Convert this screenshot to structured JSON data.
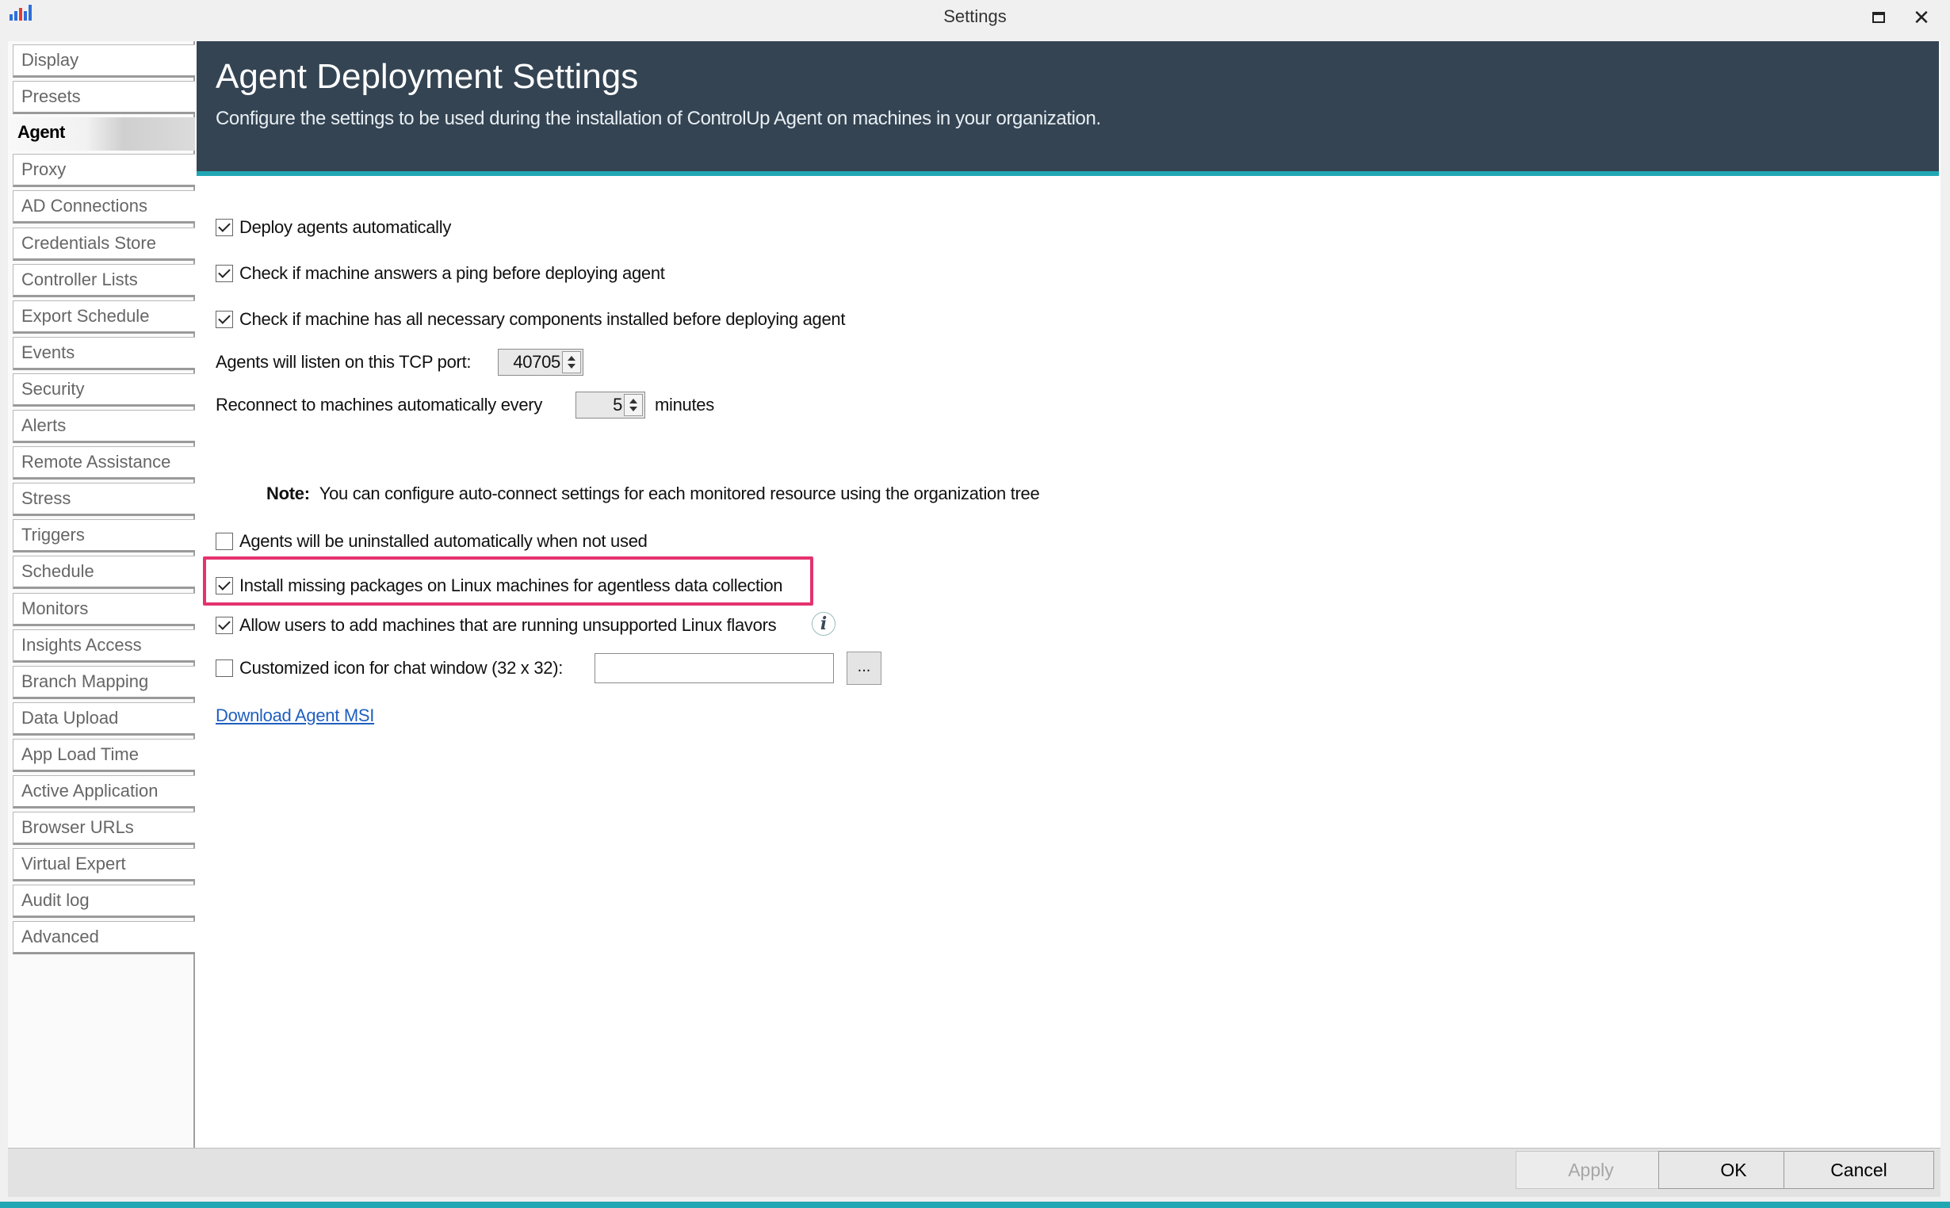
{
  "window": {
    "title": "Settings",
    "maximize_label": "",
    "close_label": "✕"
  },
  "sidebar": {
    "items": [
      {
        "label": "Display"
      },
      {
        "label": "Presets"
      },
      {
        "label": "Agent",
        "selected": true
      },
      {
        "label": "Proxy"
      },
      {
        "label": "AD Connections"
      },
      {
        "label": "Credentials Store"
      },
      {
        "label": "Controller Lists"
      },
      {
        "label": "Export Schedule"
      },
      {
        "label": "Events"
      },
      {
        "label": "Security"
      },
      {
        "label": "Alerts"
      },
      {
        "label": "Remote Assistance"
      },
      {
        "label": "Stress"
      },
      {
        "label": "Triggers"
      },
      {
        "label": "Schedule"
      },
      {
        "label": "Monitors"
      },
      {
        "label": "Insights Access"
      },
      {
        "label": "Branch Mapping"
      },
      {
        "label": "Data Upload"
      },
      {
        "label": "App Load Time"
      },
      {
        "label": "Active Application"
      },
      {
        "label": "Browser URLs"
      },
      {
        "label": "Virtual Expert"
      },
      {
        "label": "Audit log"
      },
      {
        "label": "Advanced"
      }
    ]
  },
  "header": {
    "title": "Agent Deployment Settings",
    "subtitle": "Configure the settings to be used during the installation of ControlUp Agent on machines in your organization."
  },
  "settings": {
    "deploy_auto": {
      "label": "Deploy agents automatically",
      "checked": true
    },
    "ping_check": {
      "label": "Check if machine answers a ping before deploying agent",
      "checked": true
    },
    "components_check": {
      "label": "Check if machine has all necessary components installed before deploying agent",
      "checked": true
    },
    "tcp_port": {
      "label": "Agents will listen on this TCP port:",
      "value": "40705"
    },
    "reconnect": {
      "label": "Reconnect to machines automatically every",
      "value": "5",
      "unit": "minutes"
    },
    "note": {
      "label": "Note:",
      "text": "You can configure auto-connect settings for each monitored resource using the organization tree"
    },
    "uninstall_auto": {
      "label": "Agents will be uninstalled automatically when not used",
      "checked": false
    },
    "linux_packages": {
      "label": "Install missing packages on Linux machines for agentless data collection",
      "checked": true
    },
    "linux_flavors": {
      "label": "Allow users to add machines that are running unsupported Linux flavors",
      "checked": true
    },
    "chat_icon": {
      "label": "Customized icon for chat window (32 x 32):",
      "checked": false,
      "value": "",
      "browse_label": "..."
    },
    "download_link": "Download Agent MSI"
  },
  "footer": {
    "apply_label": "Apply",
    "ok_label": "OK",
    "cancel_label": "Cancel"
  },
  "colors": {
    "header_bg": "#344453",
    "accent": "#21a7b4",
    "highlight": "#e4336f",
    "link": "#1f5fbf"
  }
}
